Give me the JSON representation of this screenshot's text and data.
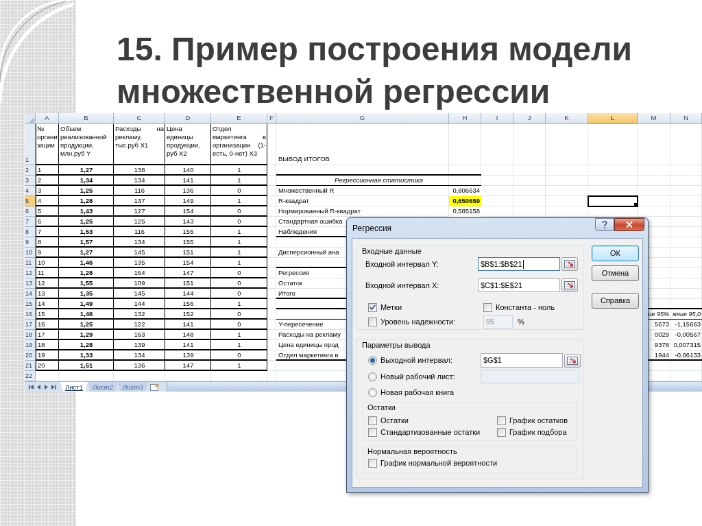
{
  "slide": {
    "title": "15. Пример построения модели множественной регрессии"
  },
  "spreadsheet": {
    "column_headers": [
      {
        "label": "A",
        "selected": false
      },
      {
        "label": "B",
        "selected": false
      },
      {
        "label": "C",
        "selected": false
      },
      {
        "label": "D",
        "selected": false
      },
      {
        "label": "E",
        "selected": false
      },
      {
        "label": "F",
        "selected": false
      },
      {
        "label": "G",
        "selected": false
      },
      {
        "label": "H",
        "selected": false
      },
      {
        "label": "I",
        "selected": false
      },
      {
        "label": "J",
        "selected": false
      },
      {
        "label": "K",
        "selected": false
      },
      {
        "label": "L",
        "selected": true
      },
      {
        "label": "M",
        "selected": false
      },
      {
        "label": "N",
        "selected": false
      }
    ],
    "row_headers": [
      {
        "label": "1",
        "selected": false
      },
      {
        "label": "2",
        "selected": false
      },
      {
        "label": "3",
        "selected": false
      },
      {
        "label": "4",
        "selected": false
      },
      {
        "label": "5",
        "selected": true
      },
      {
        "label": "6",
        "selected": false
      },
      {
        "label": "7",
        "selected": false
      },
      {
        "label": "8",
        "selected": false
      },
      {
        "label": "9",
        "selected": false
      },
      {
        "label": "10",
        "selected": false
      },
      {
        "label": "11",
        "selected": false
      },
      {
        "label": "12",
        "selected": false
      },
      {
        "label": "13",
        "selected": false
      },
      {
        "label": "14",
        "selected": false
      },
      {
        "label": "15",
        "selected": false
      },
      {
        "label": "16",
        "selected": false
      },
      {
        "label": "17",
        "selected": false
      },
      {
        "label": "18",
        "selected": false
      },
      {
        "label": "19",
        "selected": false
      },
      {
        "label": "20",
        "selected": false
      },
      {
        "label": "21",
        "selected": false
      },
      {
        "label": "22",
        "selected": false
      }
    ],
    "data_table": {
      "header": [
        "№ организации",
        "Объем реализованной продукции, млн.руб Y",
        "Расходы на рекламу, тыс.руб X1",
        "Цена единицы продукции, руб X2",
        "Отдел маркетинга в организации (1-есть, 0-нет) X3"
      ],
      "rows": [
        [
          "1",
          "1,27",
          "138",
          "140",
          "1"
        ],
        [
          "2",
          "1,34",
          "134",
          "141",
          "1"
        ],
        [
          "3",
          "1,25",
          "116",
          "136",
          "0"
        ],
        [
          "4",
          "1,28",
          "137",
          "149",
          "1"
        ],
        [
          "5",
          "1,43",
          "127",
          "154",
          "0"
        ],
        [
          "6",
          "1,25",
          "125",
          "143",
          "0"
        ],
        [
          "7",
          "1,53",
          "116",
          "155",
          "1"
        ],
        [
          "8",
          "1,57",
          "134",
          "155",
          "1"
        ],
        [
          "9",
          "1,27",
          "145",
          "151",
          "1"
        ],
        [
          "10",
          "1,46",
          "135",
          "154",
          "1"
        ],
        [
          "11",
          "1,28",
          "164",
          "147",
          "0"
        ],
        [
          "12",
          "1,55",
          "109",
          "151",
          "0"
        ],
        [
          "13",
          "1,35",
          "145",
          "144",
          "0"
        ],
        [
          "14",
          "1,49",
          "144",
          "156",
          "1"
        ],
        [
          "15",
          "1,46",
          "132",
          "152",
          "0"
        ],
        [
          "16",
          "1,25",
          "122",
          "141",
          "0"
        ],
        [
          "17",
          "1,29",
          "163",
          "148",
          "1"
        ],
        [
          "18",
          "1,28",
          "139",
          "141",
          "1"
        ],
        [
          "19",
          "1,33",
          "134",
          "139",
          "0"
        ],
        [
          "20",
          "1,51",
          "136",
          "147",
          "1"
        ]
      ]
    },
    "output": {
      "title": "ВЫВОД ИТОГОВ",
      "regression_statistics": {
        "heading": "Регрессионная статистика",
        "rows": [
          {
            "label": "Множественный R",
            "value": "0,806634",
            "highlighted": false
          },
          {
            "label": "R-квадрат",
            "value": "0,650659",
            "highlighted": true
          },
          {
            "label": "Нормированный R-квадрат",
            "value": "0,585158",
            "highlighted": false
          },
          {
            "label": "Стандартная ошибка"
          },
          {
            "label": "Наблюдения"
          }
        ]
      },
      "anova": {
        "heading": "Дисперсионный ана",
        "rows": [
          "Регрессия",
          "Остаток",
          "Итого"
        ]
      },
      "coefficients": {
        "column_m_header": "ие 95%",
        "column_n_header": "жние 95,0",
        "rows": [
          {
            "label": "Y-пересечение",
            "column_m": "5673",
            "column_n": "-1,15663"
          },
          {
            "label": "Расходы на рекламу",
            "column_m": "0029",
            "column_n": "-0,00567"
          },
          {
            "label": "Цена единицы прод",
            "column_m": "9378",
            "column_n": "0,007315"
          },
          {
            "label": "Отдел маркетинга в",
            "column_m": "1944",
            "column_n": "-0,06133"
          }
        ]
      }
    },
    "sheet_tabs": [
      {
        "label": "Лист1",
        "selected": true
      },
      {
        "label": "Лист2",
        "selected": false
      },
      {
        "label": "Лист3",
        "selected": false
      }
    ]
  },
  "dialog": {
    "title": "Регрессия",
    "input_group": {
      "title": "Входные данные",
      "fields": [
        {
          "label": "Входной интервал Y:",
          "value": "$B$1:$B$21",
          "focused": true
        },
        {
          "label": "Входной интервал X:",
          "value": "$C$1:$E$21",
          "focused": false
        }
      ],
      "options": [
        {
          "label": "Метки",
          "checked": true
        },
        {
          "label": "Константа - ноль",
          "checked": false
        },
        {
          "label": "Уровень надежности:",
          "checked": false
        }
      ],
      "confidence": {
        "value": "95",
        "unit": "%",
        "disabled": true
      }
    },
    "buttons": [
      {
        "label": "ОК",
        "default": true
      },
      {
        "label": "Отмена",
        "default": false
      },
      {
        "label": "Справка",
        "default": false
      }
    ],
    "output_group": {
      "title": "Параметры вывода",
      "destinations": [
        {
          "label": "Выходной интервал:",
          "selected": true,
          "kind": "field",
          "value": "$G$1",
          "disabled": false
        },
        {
          "label": "Новый рабочий лист:",
          "selected": false,
          "kind": "field",
          "disabled": true
        },
        {
          "label": "Новая рабочая книга",
          "selected": false,
          "kind": "plain"
        }
      ],
      "residuals": {
        "title": "Остатки",
        "options": [
          {
            "label": "Остатки",
            "checked": false
          },
          {
            "label": "График остатков",
            "checked": false
          },
          {
            "label": "Стандартизованные остатки",
            "checked": false
          },
          {
            "label": "График подбора",
            "checked": false
          }
        ]
      },
      "normal_probability": {
        "title": "Нормальная вероятность",
        "options": [
          {
            "label": "График нормальной вероятности",
            "checked": false
          }
        ]
      }
    }
  }
}
